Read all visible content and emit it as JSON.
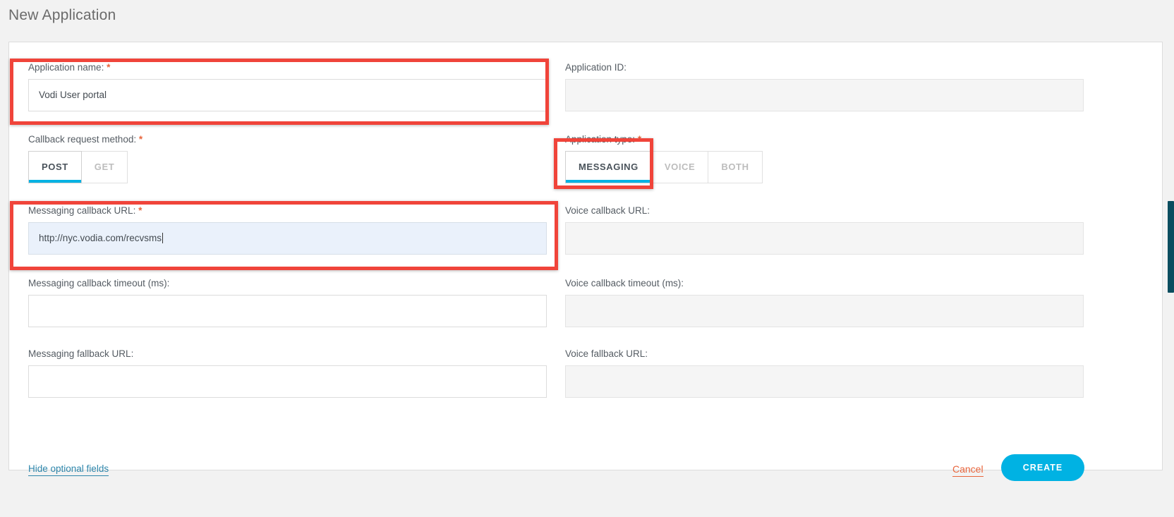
{
  "page": {
    "title": "New Application"
  },
  "form": {
    "fields": {
      "application_name": {
        "label": "Application name:",
        "required": true,
        "value": "Vodi User portal",
        "state": "editable"
      },
      "application_id": {
        "label": "Application ID:",
        "required": false,
        "value": "",
        "state": "disabled"
      },
      "callback_request_method": {
        "label": "Callback request method:",
        "required": true,
        "options": [
          "POST",
          "GET"
        ],
        "selected": "POST"
      },
      "application_type": {
        "label": "Application type:",
        "required": true,
        "options": [
          "MESSAGING",
          "VOICE",
          "BOTH"
        ],
        "selected": "MESSAGING"
      },
      "messaging_callback_url": {
        "label": "Messaging callback URL:",
        "required": true,
        "value": "http://nyc.vodia.com/recvsms",
        "state": "focused"
      },
      "voice_callback_url": {
        "label": "Voice callback URL:",
        "required": false,
        "value": "",
        "state": "disabled"
      },
      "messaging_callback_timeout": {
        "label": "Messaging callback timeout (ms):",
        "required": false,
        "value": "",
        "state": "editable"
      },
      "voice_callback_timeout": {
        "label": "Voice callback timeout (ms):",
        "required": false,
        "value": "",
        "state": "disabled"
      },
      "messaging_fallback_url": {
        "label": "Messaging fallback URL:",
        "required": false,
        "value": "",
        "state": "editable"
      },
      "voice_fallback_url": {
        "label": "Voice fallback URL:",
        "required": false,
        "value": "",
        "state": "disabled"
      }
    },
    "footer": {
      "hide_optional_link": "Hide optional fields",
      "cancel_label": "Cancel",
      "create_label": "CREATE"
    }
  },
  "annotations": {
    "count": 3,
    "color": "#f0443a",
    "targets": [
      "application-name-field",
      "application-type-toggle",
      "messaging-callback-url-field"
    ]
  },
  "colors": {
    "accent": "#00b2e3",
    "required_star": "#e8653c",
    "link": "#2e86ab",
    "cancel": "#e8653c",
    "annotation": "#f0443a",
    "scrollbar_thumb": "#0b4d5f",
    "page_background": "#f2f2f2"
  },
  "symbols": {
    "asterisk": "*"
  }
}
